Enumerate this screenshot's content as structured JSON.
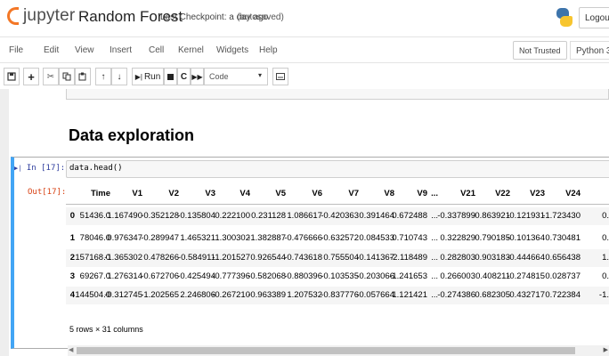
{
  "header": {
    "app_name": "jupyter",
    "notebook_title": "Random Forest",
    "checkpoint": "Last Checkpoint: a day ago",
    "autosave_status": "(autosaved)",
    "logout_label": "Logout"
  },
  "menubar": {
    "items": [
      "File",
      "Edit",
      "View",
      "Insert",
      "Cell",
      "Kernel",
      "Widgets",
      "Help"
    ],
    "trust_status": "Not Trusted",
    "kernel": "Python 3"
  },
  "toolbar": {
    "run_label": "Run",
    "cell_type": "Code"
  },
  "notebook": {
    "section_heading": "Data exploration",
    "cell": {
      "in_prompt": "In [17]:",
      "code": "data.head()",
      "out_prompt": "Out[17]:"
    },
    "dataframe": {
      "columns": [
        "",
        "Time",
        "V1",
        "V2",
        "V3",
        "V4",
        "V5",
        "V6",
        "V7",
        "V8",
        "V9",
        "...",
        "V21",
        "V22",
        "V23",
        "V24",
        ""
      ],
      "rows": [
        [
          "0",
          "51436.0",
          "1.167490",
          "-0.352128",
          "-0.135804",
          "0.222100",
          "0.231128",
          "1.086617",
          "-0.420363",
          "0.391464",
          "0.672488",
          "...",
          "-0.337899",
          "-0.863921",
          "-0.121931",
          "-1.723430",
          "0."
        ],
        [
          "1",
          "78046.0",
          "0.976347",
          "-0.289947",
          "1.465321",
          "1.300302",
          "-1.382887",
          "-0.476666",
          "-0.632572",
          "0.084533",
          "0.710743",
          "...",
          "0.322829",
          "0.790185",
          "-0.101364",
          "0.730481",
          "0."
        ],
        [
          "2",
          "157168.0",
          "-1.365302",
          "0.478266",
          "-0.584911",
          "-1.201527",
          "0.926544",
          "-0.743618",
          "0.755504",
          "-0.141367",
          "-2.118489",
          "...",
          "0.282803",
          "0.903183",
          "-0.444664",
          "0.656438",
          "1."
        ],
        [
          "3",
          "69267.0",
          "1.276314",
          "-0.672706",
          "-0.425494",
          "-0.777396",
          "-0.582068",
          "-0.880396",
          "-0.103535",
          "-0.203066",
          "-1.241653",
          "...",
          "0.266003",
          "0.408211",
          "-0.274815",
          "0.028737",
          "0."
        ],
        [
          "4",
          "144504.0",
          "-0.312745",
          "-1.202565",
          "2.246806",
          "-0.267210",
          "-0.963389",
          "1.207532",
          "-0.837776",
          "-0.057664",
          "1.121421",
          "...",
          "-0.274386",
          "0.682305",
          "0.432717",
          "0.722384",
          "-1."
        ]
      ],
      "shape_text": "5 rows × 31 columns"
    }
  },
  "colors": {
    "jupyter_orange": "#f37726",
    "prompt_in": "#303f9f",
    "prompt_out": "#d84315",
    "selected_cell": "#42a5f5"
  }
}
